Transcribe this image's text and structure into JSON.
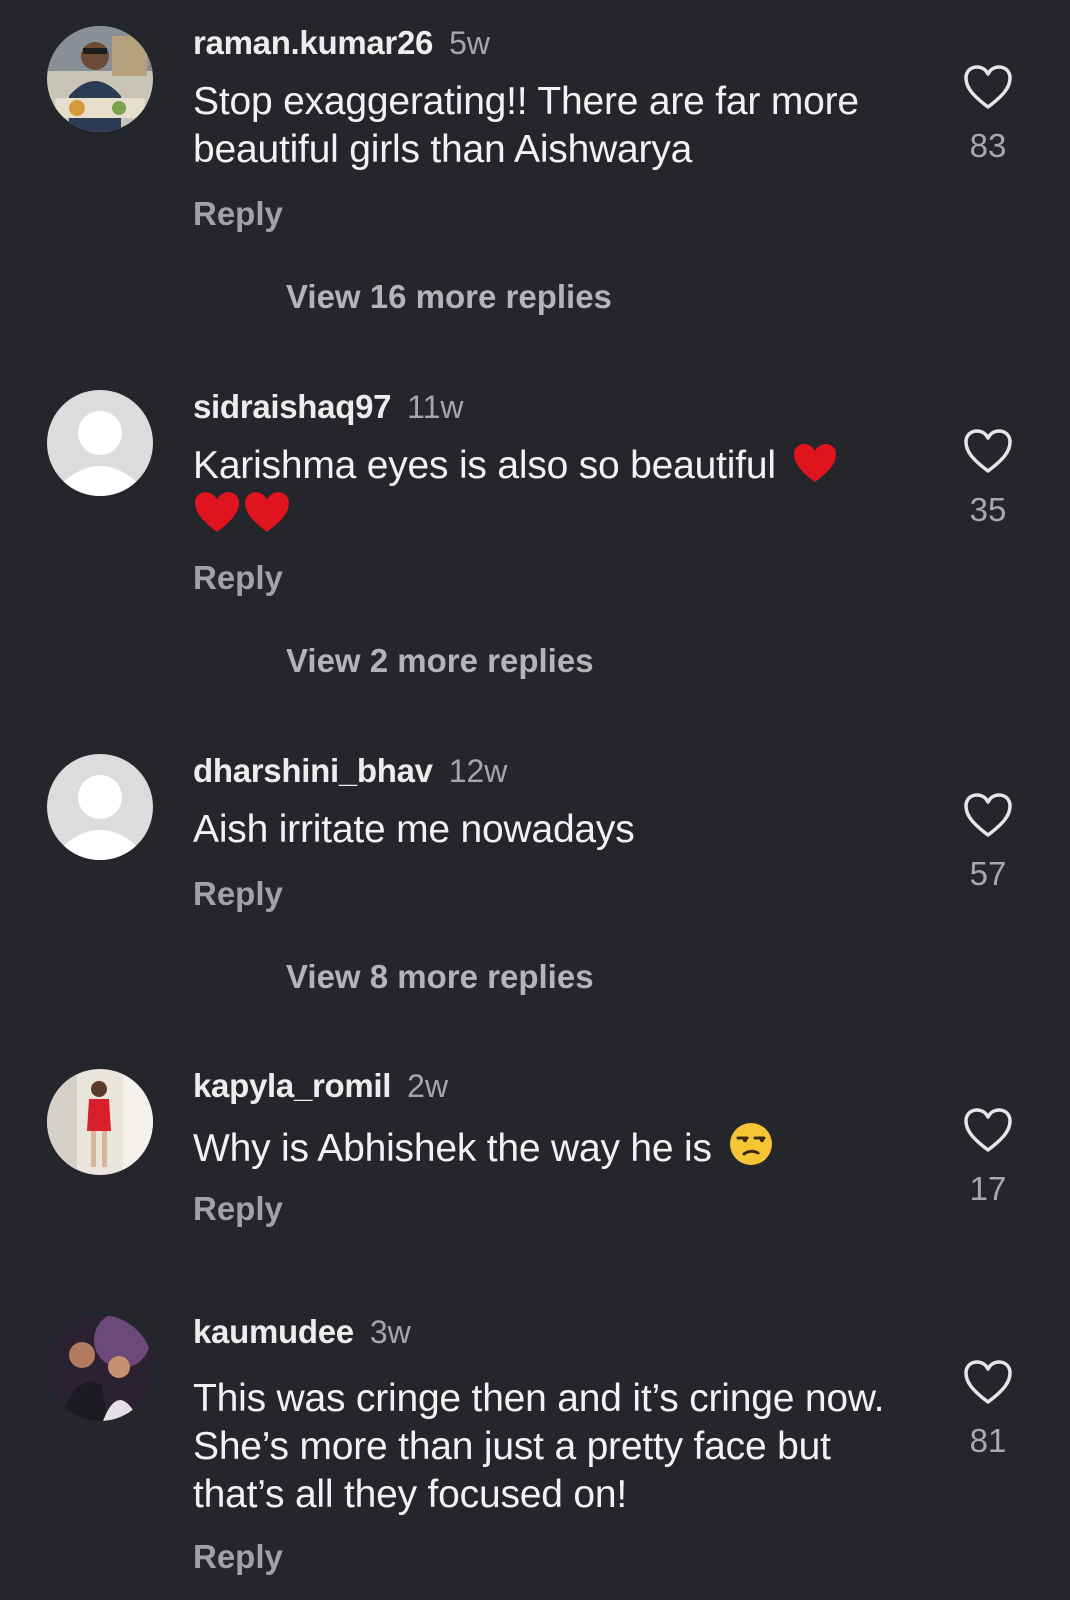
{
  "comments": [
    {
      "username": "raman.kumar26",
      "time": "5w",
      "text": "Stop exaggerating!! There are far more beautiful girls than Aishwarya",
      "reply_label": "Reply",
      "likes": "83",
      "view_replies": "View 16 more replies",
      "avatar_icon": "user-photo-icon"
    },
    {
      "username": "sidraishaq97",
      "time": "11w",
      "text": "Karishma eyes is also so beautiful",
      "emoji": [
        "red-heart-icon",
        "red-heart-icon",
        "red-heart-icon"
      ],
      "reply_label": "Reply",
      "likes": "35",
      "view_replies": "View 2 more replies",
      "avatar_icon": "default-avatar-icon"
    },
    {
      "username": "dharshini_bhav",
      "time": "12w",
      "text": "Aish irritate me nowadays",
      "reply_label": "Reply",
      "likes": "57",
      "view_replies": "View 8 more replies",
      "avatar_icon": "default-avatar-icon"
    },
    {
      "username": "kapyla_romil",
      "time": "2w",
      "text": "Why is Abhishek the way he is",
      "emoji": [
        "unamused-face-icon"
      ],
      "reply_label": "Reply",
      "likes": "17",
      "avatar_icon": "user-photo-icon"
    },
    {
      "username": "kaumudee",
      "time": "3w",
      "text": "This was cringe then and it’s cringe now. She’s more than just a pretty face but that’s all they focused on!",
      "reply_label": "Reply",
      "likes": "81",
      "avatar_icon": "user-photo-icon"
    }
  ],
  "colors": {
    "background": "#24262b",
    "primary_text": "#f2f2f2",
    "secondary_text": "#a5a6aa",
    "heart_emoji": "#e0141e"
  }
}
